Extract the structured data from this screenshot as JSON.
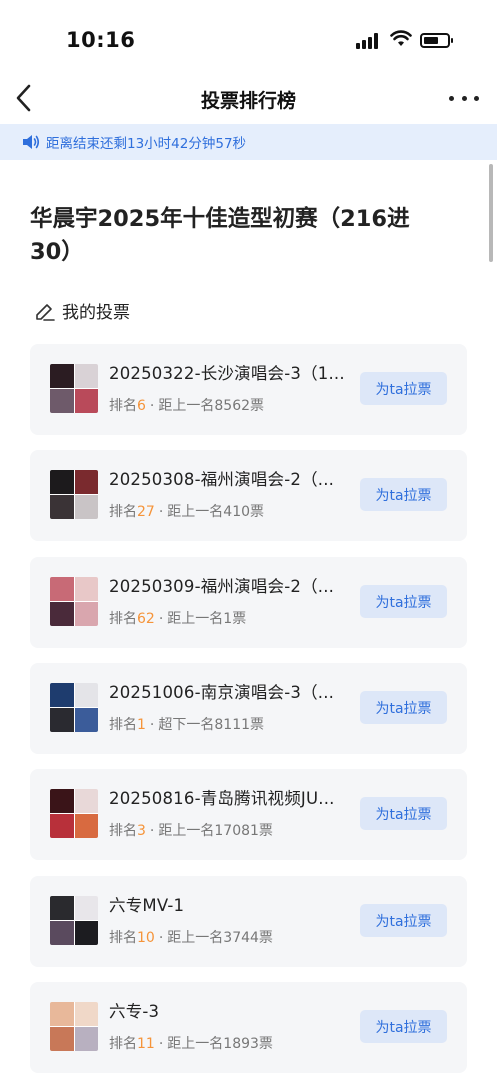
{
  "status_bar": {
    "time": "10:16"
  },
  "nav": {
    "title": "投票排行榜"
  },
  "banner": {
    "text": "距离结束还剩13小时42分钟57秒"
  },
  "contest_title": "华晨宇2025年十佳造型初赛（216进30）",
  "section": {
    "label": "我的投票"
  },
  "labels": {
    "rank_prefix": "排名",
    "separator": "·"
  },
  "entries": [
    {
      "title": "20250322-长沙演唱会-3（1...",
      "rank": "6",
      "gap_text": "距上一名8562票",
      "button": "为ta拉票",
      "thumb_colors": [
        "#2b1c22",
        "#d9d2d6",
        "#6e5a6a",
        "#b94a5a"
      ]
    },
    {
      "title": "20250308-福州演唱会-2（...",
      "rank": "27",
      "gap_text": "距上一名410票",
      "button": "为ta拉票",
      "thumb_colors": [
        "#1c1a1c",
        "#7a2a2e",
        "#3a3336",
        "#c9c4c6"
      ]
    },
    {
      "title": "20250309-福州演唱会-2（...",
      "rank": "62",
      "gap_text": "距上一名1票",
      "button": "为ta拉票",
      "thumb_colors": [
        "#c86a76",
        "#e8c8c8",
        "#4a2a3a",
        "#d9a6ae"
      ]
    },
    {
      "title": "20251006-南京演唱会-3（...",
      "rank": "1",
      "gap_text": "超下一名8111票",
      "button": "为ta拉票",
      "thumb_colors": [
        "#1e3c6e",
        "#e4e4e8",
        "#2a2a30",
        "#3b5c9a"
      ]
    },
    {
      "title": "20250816-青岛腾讯视频JU...",
      "rank": "3",
      "gap_text": "距上一名17081票",
      "button": "为ta拉票",
      "thumb_colors": [
        "#3a1418",
        "#e8d8d8",
        "#b8303a",
        "#d86a40"
      ]
    },
    {
      "title": "六专MV-1",
      "rank": "10",
      "gap_text": "距上一名3744票",
      "button": "为ta拉票",
      "thumb_colors": [
        "#2a2a2e",
        "#e8e6ea",
        "#5a4a5e",
        "#1c1c20"
      ]
    },
    {
      "title": "六专-3",
      "rank": "11",
      "gap_text": "距上一名1893票",
      "button": "为ta拉票",
      "thumb_colors": [
        "#e8b89a",
        "#f0d8c8",
        "#c87858",
        "#b8b0c0"
      ]
    }
  ]
}
